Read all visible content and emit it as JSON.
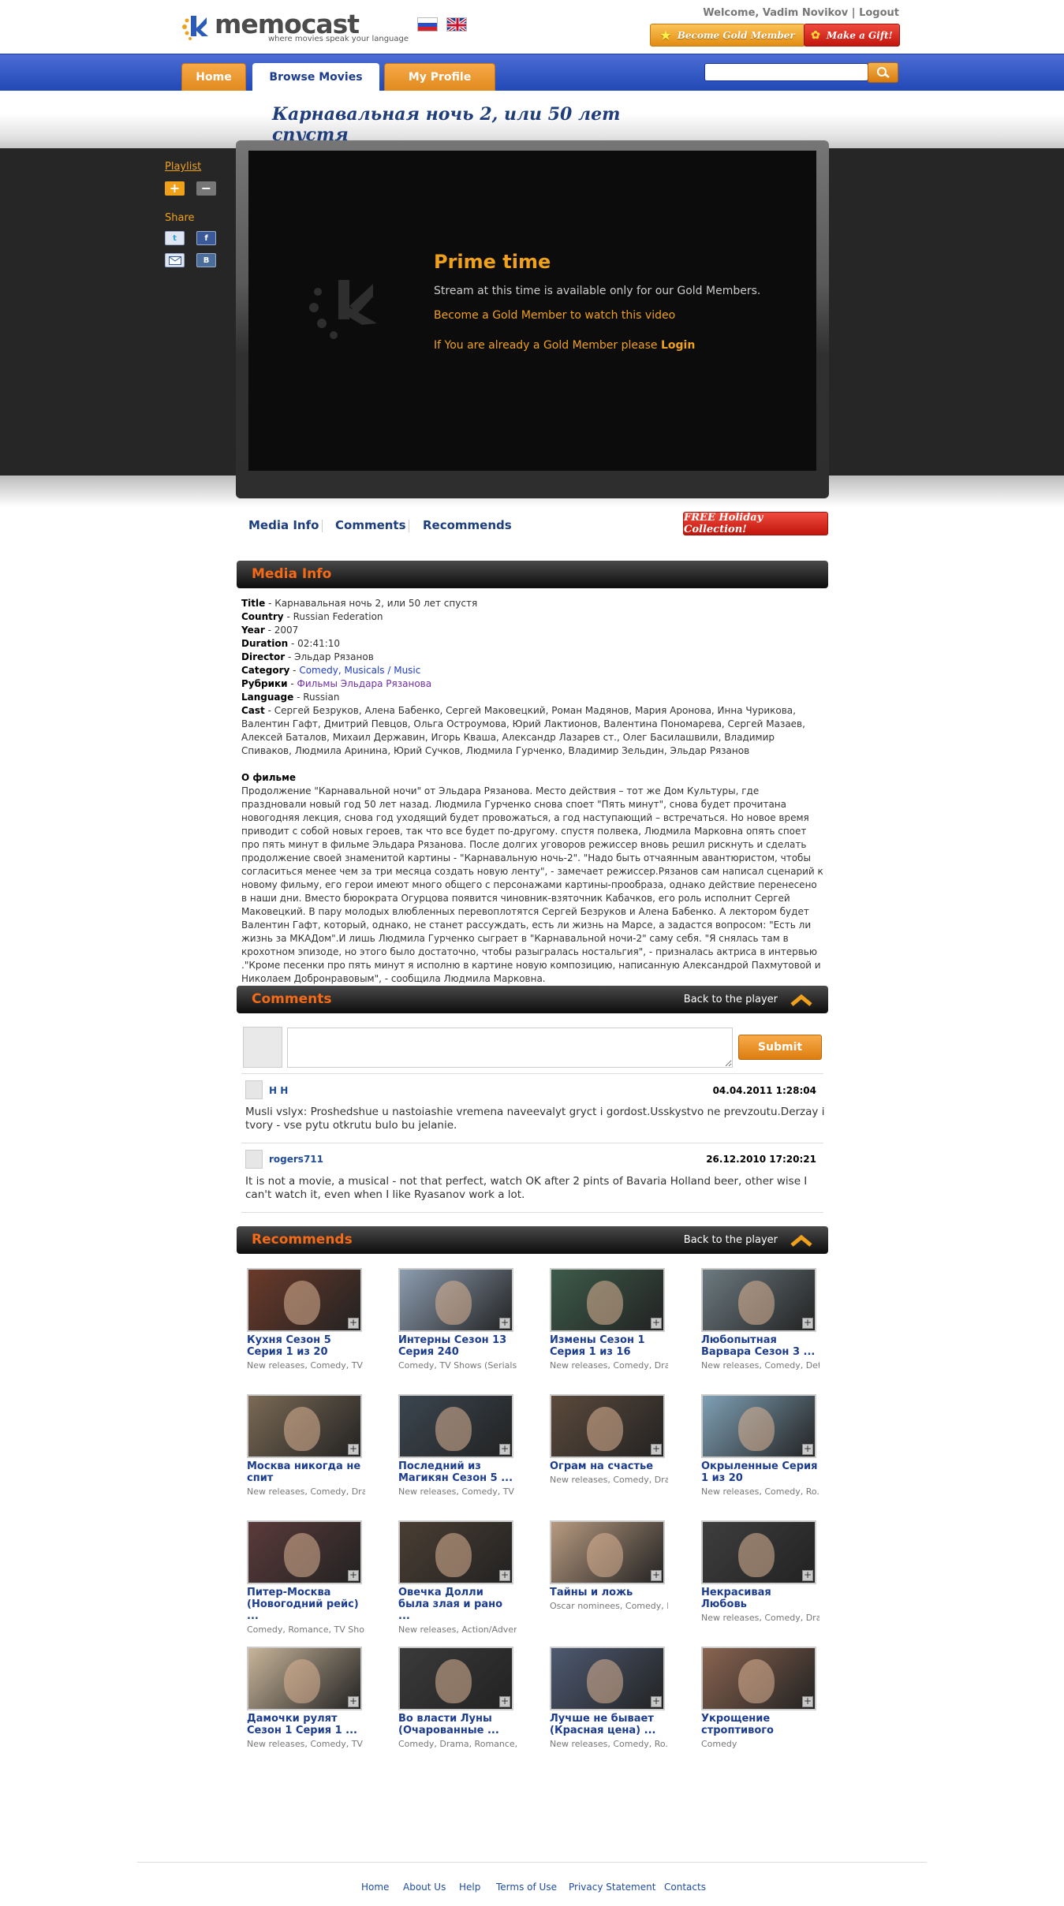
{
  "header": {
    "logo_name": "memocast",
    "logo_tagline": "where movies speak your language",
    "welcome_text": "Welcome, Vadim Novikov",
    "logout_label": "Logout",
    "gold_member_label": "Become Gold Member",
    "gift_label": "Make a Gift!"
  },
  "nav": {
    "tabs": [
      {
        "label": "Home"
      },
      {
        "label": "Browse Movies"
      },
      {
        "label": "My Profile"
      }
    ],
    "search_placeholder": ""
  },
  "movie": {
    "title": "Карнавальная ночь 2, или 50 лет спустя"
  },
  "sidebar": {
    "playlist_label": "Playlist",
    "add_label": "+",
    "remove_label": "−",
    "share_label": "Share"
  },
  "player": {
    "heading": "Prime time",
    "message": "Stream at this time is available only for our Gold Members.",
    "gold_link": "Become a Gold Member to watch this video",
    "login_prefix": "If You are already a Gold Member please",
    "login_link": "Login"
  },
  "subtabs": {
    "media_info": "Media Info",
    "comments": "Comments",
    "recommends": "Recommends",
    "holiday": "FREE Holiday Collection!"
  },
  "media_info": {
    "section_title": "Media Info",
    "fields": [
      {
        "label": "Title",
        "value": "Карнавальная ночь 2, или 50 лет спустя"
      },
      {
        "label": "Country",
        "value": "Russian Federation"
      },
      {
        "label": "Year",
        "value": "2007"
      },
      {
        "label": "Duration",
        "value": "02:41:10"
      },
      {
        "label": "Director",
        "value": "Эльдар Рязанов"
      }
    ],
    "category_label": "Category",
    "category_value": "Comedy, Musicals / Music",
    "rubrics_label": "Рубрики",
    "rubrics_value": "Фильмы Эльдара Рязанова",
    "language_label": "Language",
    "language_value": "Russian",
    "cast_label": "Cast",
    "cast_value": "Сергей Безруков, Алена Бабенко, Сергей Маковецкий, Роман Мадянов, Мария Аронова, Инна Чурикова, Валентин Гафт, Дмитрий Певцов, Ольга Остроумова, Юрий Лактионов, Валентина Пономарева, Сергей Мазаев, Алексей Баталов, Михаил Державин, Игорь Кваша, Александр Лазарев ст., Олег Басилашвили, Владимир Спиваков, Людмила Аринина, Юрий Сучков, Людмила Гурченко, Владимир Зельдин, Эльдар Рязанов",
    "about_label": "О фильме",
    "about_text": "Продолжение \"Карнавальной ночи\" от Эльдара Рязанова. Место действия – тот же Дом Культуры, где праздновали новый год 50 лет назад. Людмила Гурченко снова споет \"Пять минут\", снова будет прочитана новогодняя лекция, снова год уходящий будет провожаться, а год наступающий – встречаться. Но новое время приводит с собой новых героев, так что все будет по-другому. спустя полвека, Людмила Марковна опять споет про пять минут в фильме Эльдара Рязанова. После долгих уговоров режиссер вновь решил рискнуть и сделать продолжение своей знаменитой картины - \"Карнавальную ночь-2\". \"Надо быть отчаянным авантюристом, чтобы согласиться менее чем за три месяца создать новую ленту\", - замечает режиссер.Рязанов сам написал сценарий к новому фильму, его герои имеют много общего с персонажами картины-прообраза, однако действие перенесено в наши дни. Вместо бюрократа Огурцова появится чиновник-взяточник Кабачков, его роль исполнит Сергей Маковецкий. В пару молодых влюбленных перевоплотятся Сергей Безруков и Алена Бабенко. А лектором будет Валентин Гафт, который, однако, не станет рассуждать, есть ли жизнь на Марсе, а задастся вопросом: \"Есть ли жизнь за МКАДом\".И лишь Людмила Гурченко сыграет в \"Карнавальной ночи-2\" саму себя. \"Я снялась там в крохотном эпизоде, но этого было достаточно, чтобы разыгралась ностальгия\", - призналась актриса в интервью .\"Кроме песенки про пять минут я исполню в картине новую композицию, написанную Александрой Пахмутовой и Николаем Добронравовым\", - сообщила Людмила Марковна."
  },
  "comments": {
    "section_title": "Comments",
    "back_label": "Back to the player",
    "submit_label": "Submit",
    "items": [
      {
        "author": "H H",
        "date": "04.04.2011 1:28:04",
        "text": "Musli vslyx: Proshedshue u nastoiashie vremena naveevalyt gryct i gordost.Usskystvo ne prevzoutu.Derzay i tvory - vse pytu otkrutu bulo bu jelanie."
      },
      {
        "author": "rogers711",
        "date": "26.12.2010 17:20:21",
        "text": "It is not a movie, a musical - not that perfect, watch OK after 2 pints of Bavaria Holland beer, other wise I can't watch it, even when I like Ryasanov work a lot."
      }
    ]
  },
  "recommends": {
    "section_title": "Recommends",
    "back_label": "Back to the player",
    "items": [
      {
        "title": "Кухня Сезон 5 Серия 1 из 20",
        "meta": "New releases, Comedy, TV ...",
        "color": "#6b3a2a"
      },
      {
        "title": "Интерны Сезон 13 Серия 240",
        "meta": "Comedy, TV Shows (Serials)...",
        "color": "#8d9db0"
      },
      {
        "title": "Измены Сезон 1 Серия 1 из 16",
        "meta": "New releases, Comedy, Dra...",
        "color": "#3d5b4a"
      },
      {
        "title": "Любопытная Варвара Сезон 3 ...",
        "meta": "New releases, Comedy, Det...",
        "color": "#6c7a80"
      },
      {
        "title": "Москва никогда не спит",
        "meta": "New releases, Comedy, Dra...",
        "color": "#7b6a55"
      },
      {
        "title": "Последний из Магикян Сезон 5 ...",
        "meta": "New releases, Comedy, TV ...",
        "color": "#3b4650"
      },
      {
        "title": "Ограм на счастье",
        "meta": "New releases, Comedy, Dra...",
        "color": "#5c4a3c"
      },
      {
        "title": "Окрыленные Серия 1 из 20",
        "meta": "New releases, Comedy, Ro...",
        "color": "#7fa0b5"
      },
      {
        "title": "Питер-Москва (Новогодний рейс) ...",
        "meta": "Comedy, Romance, TV Sho...",
        "color": "#5b3a3a"
      },
      {
        "title": "Овечка Долли была злая и рано ...",
        "meta": "New releases, Action/Adven...",
        "color": "#4a3e33"
      },
      {
        "title": "Тайны и ложь",
        "meta": "Oscar nominees, Comedy, D...",
        "color": "#b79a80"
      },
      {
        "title": "Некрасивая Любовь",
        "meta": "New releases, Comedy, Dra...",
        "color": "#3e3e3e"
      },
      {
        "title": "Дамочки рулят Сезон 1 Серия 1 ...",
        "meta": "New releases, Comedy, TV ...",
        "color": "#c8b59a"
      },
      {
        "title": "Во власти Луны (Очарованные ...",
        "meta": "Comedy, Drama, Romance, ...",
        "color": "#3a3a3a"
      },
      {
        "title": "Лучше не бывает (Красная цена) ...",
        "meta": "New releases, Comedy, Ro...",
        "color": "#4e5a72"
      },
      {
        "title": "Укрощение строптивого",
        "meta": "Comedy",
        "color": "#8a6450"
      }
    ]
  },
  "footer": {
    "links": [
      "Home",
      "About Us",
      "Help",
      "Terms of Use",
      "Privacy Statement",
      "Contacts"
    ]
  },
  "colors": {
    "accent_orange": "#f0a11c",
    "nav_blue": "#2f57c4",
    "section_title": "#f46a17",
    "link_blue": "#1c3d7e"
  }
}
